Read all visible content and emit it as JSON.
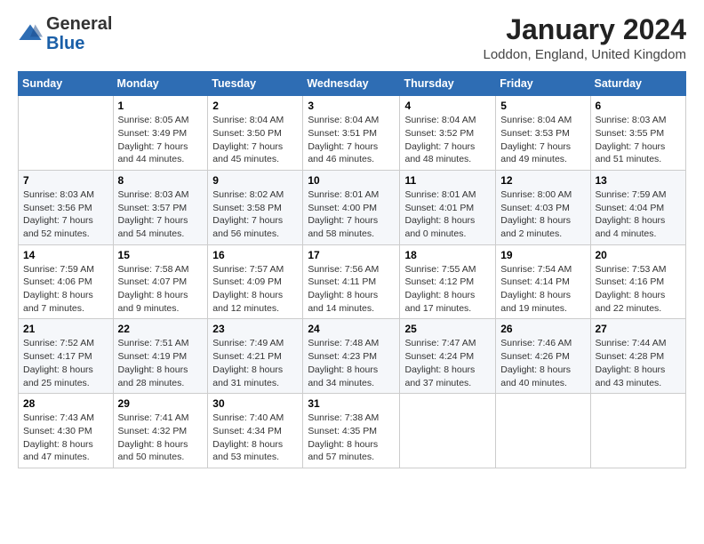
{
  "header": {
    "logo_general": "General",
    "logo_blue": "Blue",
    "title": "January 2024",
    "subtitle": "Loddon, England, United Kingdom"
  },
  "columns": [
    "Sunday",
    "Monday",
    "Tuesday",
    "Wednesday",
    "Thursday",
    "Friday",
    "Saturday"
  ],
  "weeks": [
    [
      {
        "day": "",
        "sunrise": "",
        "sunset": "",
        "daylight": ""
      },
      {
        "day": "1",
        "sunrise": "Sunrise: 8:05 AM",
        "sunset": "Sunset: 3:49 PM",
        "daylight": "Daylight: 7 hours and 44 minutes."
      },
      {
        "day": "2",
        "sunrise": "Sunrise: 8:04 AM",
        "sunset": "Sunset: 3:50 PM",
        "daylight": "Daylight: 7 hours and 45 minutes."
      },
      {
        "day": "3",
        "sunrise": "Sunrise: 8:04 AM",
        "sunset": "Sunset: 3:51 PM",
        "daylight": "Daylight: 7 hours and 46 minutes."
      },
      {
        "day": "4",
        "sunrise": "Sunrise: 8:04 AM",
        "sunset": "Sunset: 3:52 PM",
        "daylight": "Daylight: 7 hours and 48 minutes."
      },
      {
        "day": "5",
        "sunrise": "Sunrise: 8:04 AM",
        "sunset": "Sunset: 3:53 PM",
        "daylight": "Daylight: 7 hours and 49 minutes."
      },
      {
        "day": "6",
        "sunrise": "Sunrise: 8:03 AM",
        "sunset": "Sunset: 3:55 PM",
        "daylight": "Daylight: 7 hours and 51 minutes."
      }
    ],
    [
      {
        "day": "7",
        "sunrise": "Sunrise: 8:03 AM",
        "sunset": "Sunset: 3:56 PM",
        "daylight": "Daylight: 7 hours and 52 minutes."
      },
      {
        "day": "8",
        "sunrise": "Sunrise: 8:03 AM",
        "sunset": "Sunset: 3:57 PM",
        "daylight": "Daylight: 7 hours and 54 minutes."
      },
      {
        "day": "9",
        "sunrise": "Sunrise: 8:02 AM",
        "sunset": "Sunset: 3:58 PM",
        "daylight": "Daylight: 7 hours and 56 minutes."
      },
      {
        "day": "10",
        "sunrise": "Sunrise: 8:01 AM",
        "sunset": "Sunset: 4:00 PM",
        "daylight": "Daylight: 7 hours and 58 minutes."
      },
      {
        "day": "11",
        "sunrise": "Sunrise: 8:01 AM",
        "sunset": "Sunset: 4:01 PM",
        "daylight": "Daylight: 8 hours and 0 minutes."
      },
      {
        "day": "12",
        "sunrise": "Sunrise: 8:00 AM",
        "sunset": "Sunset: 4:03 PM",
        "daylight": "Daylight: 8 hours and 2 minutes."
      },
      {
        "day": "13",
        "sunrise": "Sunrise: 7:59 AM",
        "sunset": "Sunset: 4:04 PM",
        "daylight": "Daylight: 8 hours and 4 minutes."
      }
    ],
    [
      {
        "day": "14",
        "sunrise": "Sunrise: 7:59 AM",
        "sunset": "Sunset: 4:06 PM",
        "daylight": "Daylight: 8 hours and 7 minutes."
      },
      {
        "day": "15",
        "sunrise": "Sunrise: 7:58 AM",
        "sunset": "Sunset: 4:07 PM",
        "daylight": "Daylight: 8 hours and 9 minutes."
      },
      {
        "day": "16",
        "sunrise": "Sunrise: 7:57 AM",
        "sunset": "Sunset: 4:09 PM",
        "daylight": "Daylight: 8 hours and 12 minutes."
      },
      {
        "day": "17",
        "sunrise": "Sunrise: 7:56 AM",
        "sunset": "Sunset: 4:11 PM",
        "daylight": "Daylight: 8 hours and 14 minutes."
      },
      {
        "day": "18",
        "sunrise": "Sunrise: 7:55 AM",
        "sunset": "Sunset: 4:12 PM",
        "daylight": "Daylight: 8 hours and 17 minutes."
      },
      {
        "day": "19",
        "sunrise": "Sunrise: 7:54 AM",
        "sunset": "Sunset: 4:14 PM",
        "daylight": "Daylight: 8 hours and 19 minutes."
      },
      {
        "day": "20",
        "sunrise": "Sunrise: 7:53 AM",
        "sunset": "Sunset: 4:16 PM",
        "daylight": "Daylight: 8 hours and 22 minutes."
      }
    ],
    [
      {
        "day": "21",
        "sunrise": "Sunrise: 7:52 AM",
        "sunset": "Sunset: 4:17 PM",
        "daylight": "Daylight: 8 hours and 25 minutes."
      },
      {
        "day": "22",
        "sunrise": "Sunrise: 7:51 AM",
        "sunset": "Sunset: 4:19 PM",
        "daylight": "Daylight: 8 hours and 28 minutes."
      },
      {
        "day": "23",
        "sunrise": "Sunrise: 7:49 AM",
        "sunset": "Sunset: 4:21 PM",
        "daylight": "Daylight: 8 hours and 31 minutes."
      },
      {
        "day": "24",
        "sunrise": "Sunrise: 7:48 AM",
        "sunset": "Sunset: 4:23 PM",
        "daylight": "Daylight: 8 hours and 34 minutes."
      },
      {
        "day": "25",
        "sunrise": "Sunrise: 7:47 AM",
        "sunset": "Sunset: 4:24 PM",
        "daylight": "Daylight: 8 hours and 37 minutes."
      },
      {
        "day": "26",
        "sunrise": "Sunrise: 7:46 AM",
        "sunset": "Sunset: 4:26 PM",
        "daylight": "Daylight: 8 hours and 40 minutes."
      },
      {
        "day": "27",
        "sunrise": "Sunrise: 7:44 AM",
        "sunset": "Sunset: 4:28 PM",
        "daylight": "Daylight: 8 hours and 43 minutes."
      }
    ],
    [
      {
        "day": "28",
        "sunrise": "Sunrise: 7:43 AM",
        "sunset": "Sunset: 4:30 PM",
        "daylight": "Daylight: 8 hours and 47 minutes."
      },
      {
        "day": "29",
        "sunrise": "Sunrise: 7:41 AM",
        "sunset": "Sunset: 4:32 PM",
        "daylight": "Daylight: 8 hours and 50 minutes."
      },
      {
        "day": "30",
        "sunrise": "Sunrise: 7:40 AM",
        "sunset": "Sunset: 4:34 PM",
        "daylight": "Daylight: 8 hours and 53 minutes."
      },
      {
        "day": "31",
        "sunrise": "Sunrise: 7:38 AM",
        "sunset": "Sunset: 4:35 PM",
        "daylight": "Daylight: 8 hours and 57 minutes."
      },
      {
        "day": "",
        "sunrise": "",
        "sunset": "",
        "daylight": ""
      },
      {
        "day": "",
        "sunrise": "",
        "sunset": "",
        "daylight": ""
      },
      {
        "day": "",
        "sunrise": "",
        "sunset": "",
        "daylight": ""
      }
    ]
  ]
}
